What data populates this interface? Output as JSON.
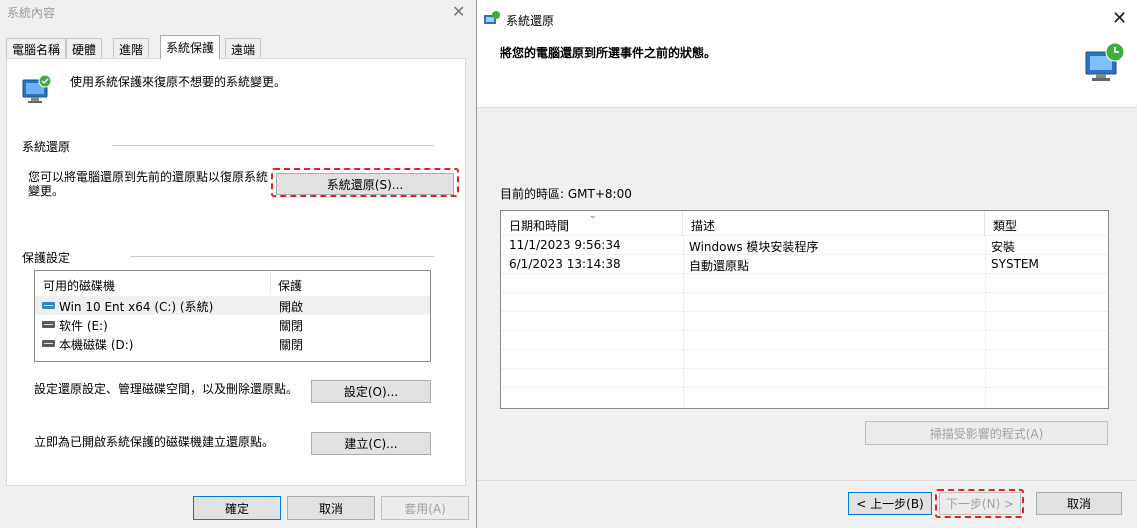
{
  "left_window": {
    "title": "系統內容",
    "tabs": [
      {
        "label": "電腦名稱"
      },
      {
        "label": "硬體"
      },
      {
        "label": "進階"
      },
      {
        "label": "系統保護"
      },
      {
        "label": "遠端"
      }
    ],
    "active_tab": "系統保護",
    "intro_text": "使用系統保護來復原不想要的系統變更。",
    "system_restore": {
      "section_label": "系統還原",
      "description_line1": "您可以將電腦還原到先前的還原點以復原系統",
      "description_line2": "變更。",
      "button_label": "系統還原(S)..."
    },
    "protection": {
      "section_label": "保護設定",
      "columns": [
        "可用的磁碟機",
        "保護"
      ],
      "drives": [
        {
          "name": "Win 10 Ent x64 (C:) (系統)",
          "status": "開啟",
          "icon": "system-drive-icon"
        },
        {
          "name": "软件 (E:)",
          "status": "關閉",
          "icon": "drive-icon"
        },
        {
          "name": "本機磁碟 (D:)",
          "status": "關閉",
          "icon": "drive-icon"
        }
      ]
    },
    "configure": {
      "text": "設定還原設定、管理磁碟空間，以及刪除還原點。",
      "button_label": "設定(O)..."
    },
    "create": {
      "text": "立即為已開啟系統保護的磁碟機建立還原點。",
      "button_label": "建立(C)..."
    },
    "footer": {
      "ok_label": "確定",
      "cancel_label": "取消",
      "apply_label": "套用(A)"
    }
  },
  "right_window": {
    "title": "系統還原",
    "heading": "將您的電腦還原到所選事件之前的狀態。",
    "timezone_text": "目前的時區: GMT+8:00",
    "table": {
      "columns": [
        "日期和時間",
        "描述",
        "類型"
      ],
      "rows": [
        {
          "datetime": "11/1/2023 9:56:34",
          "description": "Windows 模块安装程序",
          "type": "安裝"
        },
        {
          "datetime": "6/1/2023 13:14:38",
          "description": "自動還原點",
          "type": "SYSTEM"
        }
      ]
    },
    "scan_button_label": "掃描受影響的程式(A)",
    "back_button_label": "< 上一步(B)",
    "next_button_label": "下一步(N) >",
    "cancel_button_label": "取消"
  },
  "colors": {
    "highlight_dash": "#e0241b",
    "accent": "#0078d7"
  }
}
